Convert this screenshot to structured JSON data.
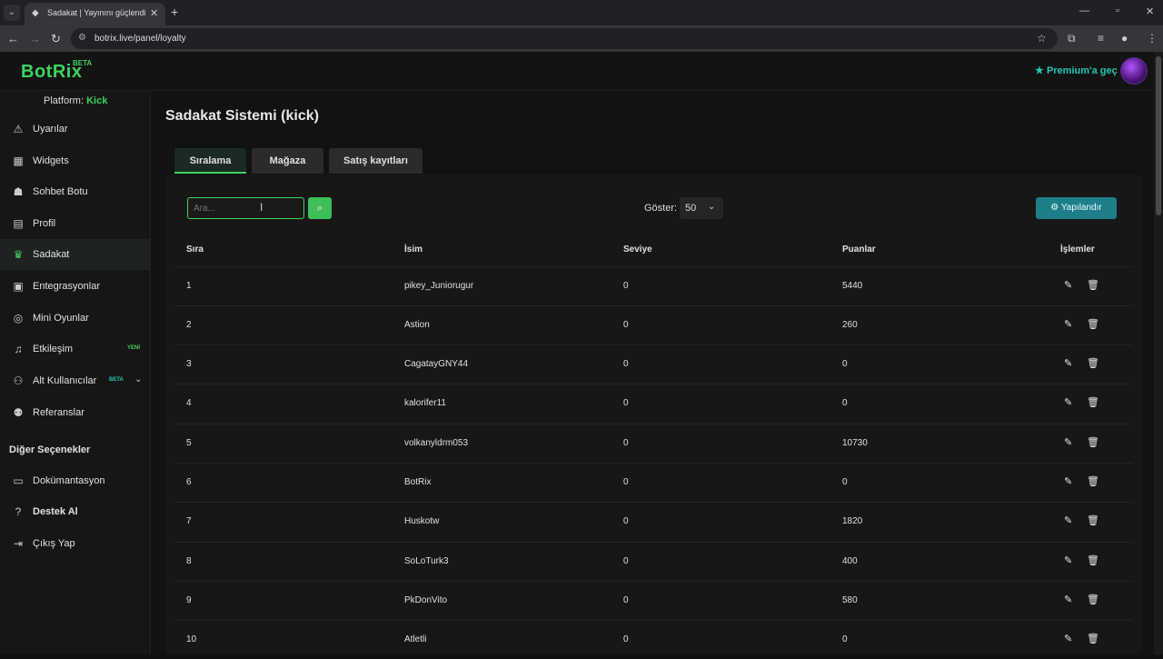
{
  "browser": {
    "tab_title": "Sadakat | Yayınını güçlendirmek",
    "url": "botrix.live/panel/loyalty"
  },
  "header": {
    "logo": "BotRix",
    "logo_badge": "BETA",
    "premium_label": "Premium'a geç"
  },
  "sidebar": {
    "platform_label": "Platform:",
    "platform_value": "Kick",
    "items": [
      {
        "label": "Uyarılar",
        "icon": "warning-icon"
      },
      {
        "label": "Widgets",
        "icon": "grid-icon"
      },
      {
        "label": "Sohbet Botu",
        "icon": "robot-icon"
      },
      {
        "label": "Profil",
        "icon": "id-card-icon"
      },
      {
        "label": "Sadakat",
        "icon": "trophy-icon"
      },
      {
        "label": "Entegrasyonlar",
        "icon": "plug-icon"
      },
      {
        "label": "Mini Oyunlar",
        "icon": "gamepad-icon"
      },
      {
        "label": "Etkileşim",
        "icon": "music-icon",
        "badge": "YENİ"
      },
      {
        "label": "Alt Kullanıcılar",
        "icon": "users-cog-icon",
        "badge": "BETA"
      },
      {
        "label": "Referanslar",
        "icon": "users-icon"
      }
    ],
    "section_title": "Diğer Seçenekler",
    "other_items": [
      {
        "label": "Dokümantasyon",
        "icon": "book-icon"
      },
      {
        "label": "Destek Al",
        "icon": "question-icon"
      },
      {
        "label": "Çıkış Yap",
        "icon": "logout-icon"
      }
    ]
  },
  "main": {
    "page_title": "Sadakat Sistemi (kick)",
    "tabs": [
      "Sıralama",
      "Mağaza",
      "Satış kayıtları"
    ],
    "search_placeholder": "Ara...",
    "show_label": "Göster:",
    "show_value": "50",
    "config_label": "Yapılandır",
    "table": {
      "headers": [
        "Sıra",
        "İsim",
        "Seviye",
        "Puanlar",
        "İşlemler"
      ],
      "rows": [
        {
          "rank": "1",
          "name": "pikey_Juniorugur",
          "level": "0",
          "points": "5440"
        },
        {
          "rank": "2",
          "name": "Astion",
          "level": "0",
          "points": "260"
        },
        {
          "rank": "3",
          "name": "CagatayGNY44",
          "level": "0",
          "points": "0"
        },
        {
          "rank": "4",
          "name": "kalorifer11",
          "level": "0",
          "points": "0"
        },
        {
          "rank": "5",
          "name": "volkanyldrm053",
          "level": "0",
          "points": "10730"
        },
        {
          "rank": "6",
          "name": "BotRix",
          "level": "0",
          "points": "0"
        },
        {
          "rank": "7",
          "name": "Huskotw",
          "level": "0",
          "points": "1820"
        },
        {
          "rank": "8",
          "name": "SoLoTurk3",
          "level": "0",
          "points": "400"
        },
        {
          "rank": "9",
          "name": "PkDonVito",
          "level": "0",
          "points": "580"
        },
        {
          "rank": "10",
          "name": "Atletli",
          "level": "0",
          "points": "0"
        }
      ]
    }
  },
  "colors": {
    "accent_green": "#3fd35f",
    "premium_teal": "#26c6b6",
    "config_button": "#1e7f8a",
    "badge_new": "#3fd35f",
    "badge_beta": "#26c6b6"
  }
}
